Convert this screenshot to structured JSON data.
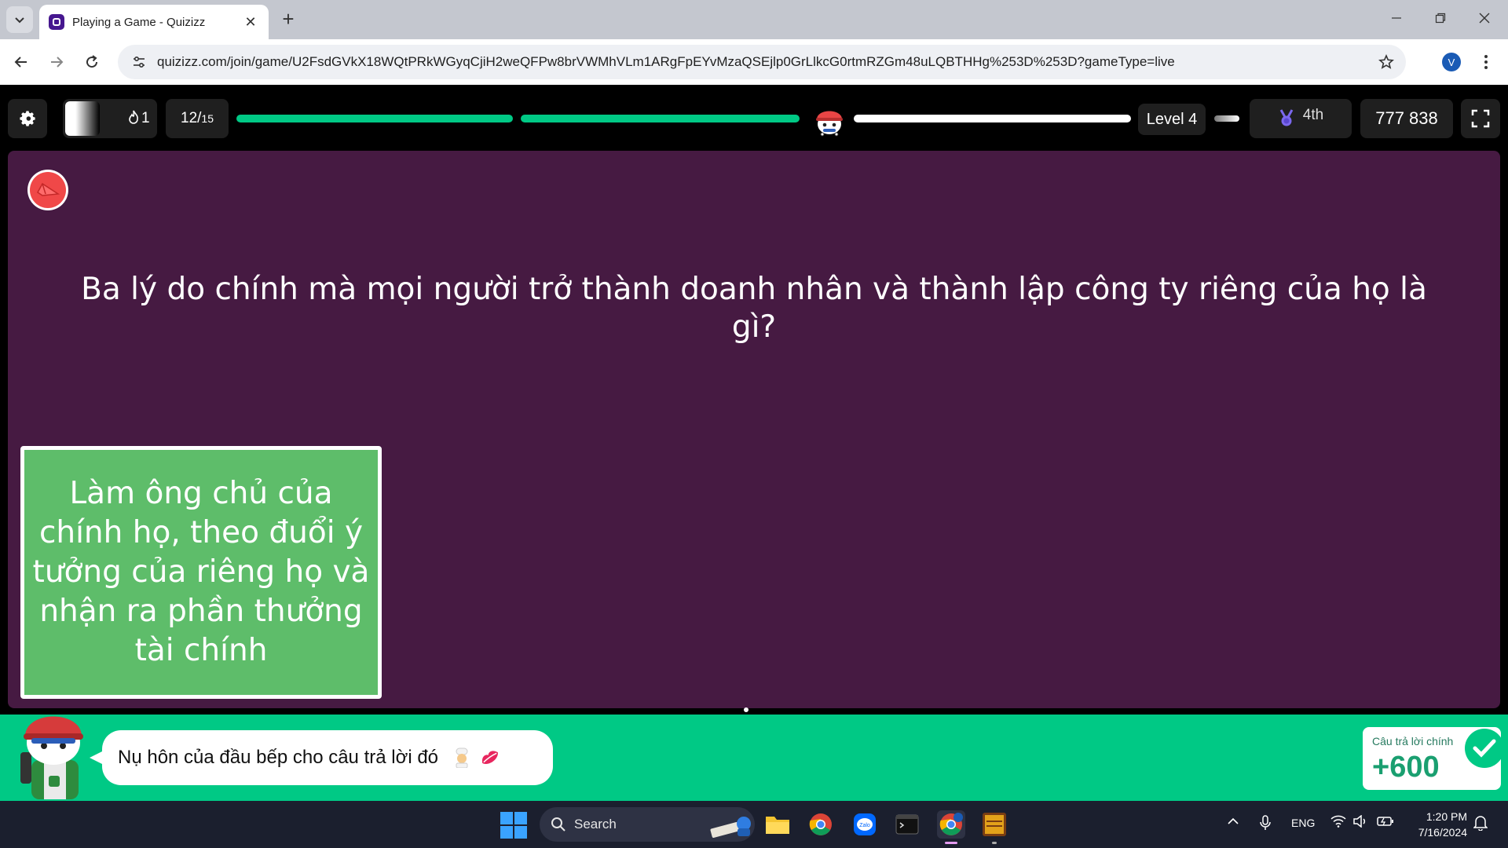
{
  "browser": {
    "tab_title": "Playing a Game - Quizizz",
    "tab_close": "✕",
    "new_tab": "+",
    "url": "quizizz.com/join/game/U2FsdGVkX18WQtPRkWGyqCjiH2weQFPw8brVWMhVLm1ARgFpEYvMzaQSEjlp0GrLlkcG0rtmRZGm48uLQBTHHg%253D%253D?gameType=live",
    "profile_initial": "V"
  },
  "game_header": {
    "streak_count": "1",
    "question_current": "12/",
    "question_total": "15",
    "progress_fraction": 0.8,
    "level_label": "Level 4",
    "rank": "4th",
    "score": "777 838"
  },
  "question": {
    "text": "Ba lý do chính mà mọi người trở thành doanh nhân và thành lập công ty riêng của họ là gì?"
  },
  "answer": {
    "text": "Làm ông chủ của chính họ, theo đuổi ý tưởng của riêng họ và nhận ra phần thưởng tài chính",
    "color": "#5ebd6a"
  },
  "feedback": {
    "message": "Nụ hôn của đầu bếp cho câu trả lời đó",
    "points_label": "Câu trả lời chính",
    "points_value": "+600"
  },
  "taskbar": {
    "search_label": "Search",
    "language": "ENG",
    "time": "1:20 PM",
    "date": "7/16/2024"
  },
  "colors": {
    "question_bg": "#461a42",
    "correct_green": "#00c985",
    "header_bg": "#000000"
  }
}
